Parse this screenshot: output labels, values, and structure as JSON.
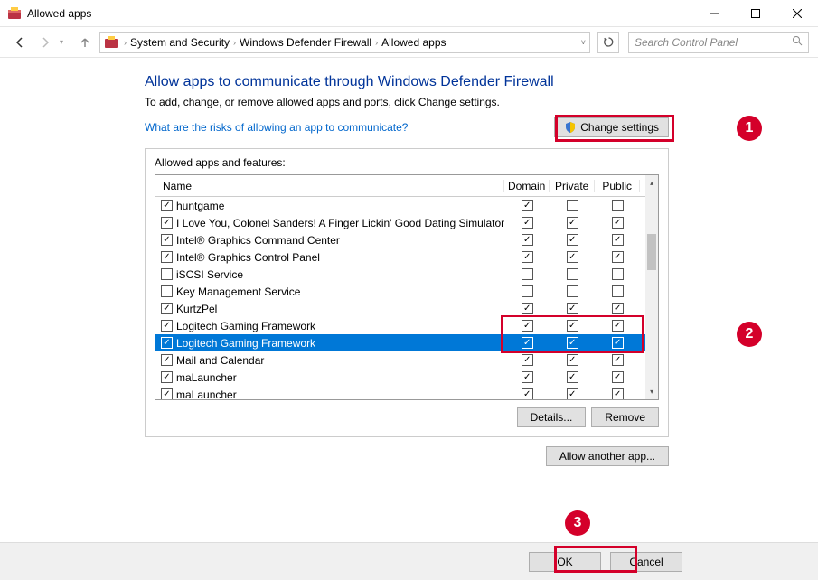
{
  "window": {
    "title": "Allowed apps"
  },
  "breadcrumb": {
    "seg1": "System and Security",
    "seg2": "Windows Defender Firewall",
    "seg3": "Allowed apps"
  },
  "search": {
    "placeholder": "Search Control Panel"
  },
  "heading": "Allow apps to communicate through Windows Defender Firewall",
  "subtext": "To add, change, or remove allowed apps and ports, click Change settings.",
  "risk_link": "What are the risks of allowing an app to communicate?",
  "change_settings": "Change settings",
  "group_label": "Allowed apps and features:",
  "columns": {
    "name": "Name",
    "domain": "Domain",
    "private": "Private",
    "public": "Public"
  },
  "rows": [
    {
      "enabled": true,
      "name": "huntgame",
      "domain": true,
      "private": false,
      "public": false,
      "selected": false
    },
    {
      "enabled": true,
      "name": "I Love You, Colonel Sanders! A Finger Lickin' Good Dating Simulator",
      "domain": true,
      "private": true,
      "public": true,
      "selected": false
    },
    {
      "enabled": true,
      "name": "Intel® Graphics Command Center",
      "domain": true,
      "private": true,
      "public": true,
      "selected": false
    },
    {
      "enabled": true,
      "name": "Intel® Graphics Control Panel",
      "domain": true,
      "private": true,
      "public": true,
      "selected": false
    },
    {
      "enabled": false,
      "name": "iSCSI Service",
      "domain": false,
      "private": false,
      "public": false,
      "selected": false
    },
    {
      "enabled": false,
      "name": "Key Management Service",
      "domain": false,
      "private": false,
      "public": false,
      "selected": false
    },
    {
      "enabled": true,
      "name": "KurtzPel",
      "domain": true,
      "private": true,
      "public": true,
      "selected": false
    },
    {
      "enabled": true,
      "name": "Logitech Gaming Framework",
      "domain": true,
      "private": true,
      "public": true,
      "selected": false
    },
    {
      "enabled": true,
      "name": "Logitech Gaming Framework",
      "domain": true,
      "private": true,
      "public": true,
      "selected": true
    },
    {
      "enabled": true,
      "name": "Mail and Calendar",
      "domain": true,
      "private": true,
      "public": true,
      "selected": false
    },
    {
      "enabled": true,
      "name": "maLauncher",
      "domain": true,
      "private": true,
      "public": true,
      "selected": false
    },
    {
      "enabled": true,
      "name": "maLauncher",
      "domain": true,
      "private": true,
      "public": true,
      "selected": false
    }
  ],
  "buttons": {
    "details": "Details...",
    "remove": "Remove",
    "allow_another": "Allow another app...",
    "ok": "OK",
    "cancel": "Cancel"
  },
  "annotations": {
    "a1": "1",
    "a2": "2",
    "a3": "3"
  }
}
